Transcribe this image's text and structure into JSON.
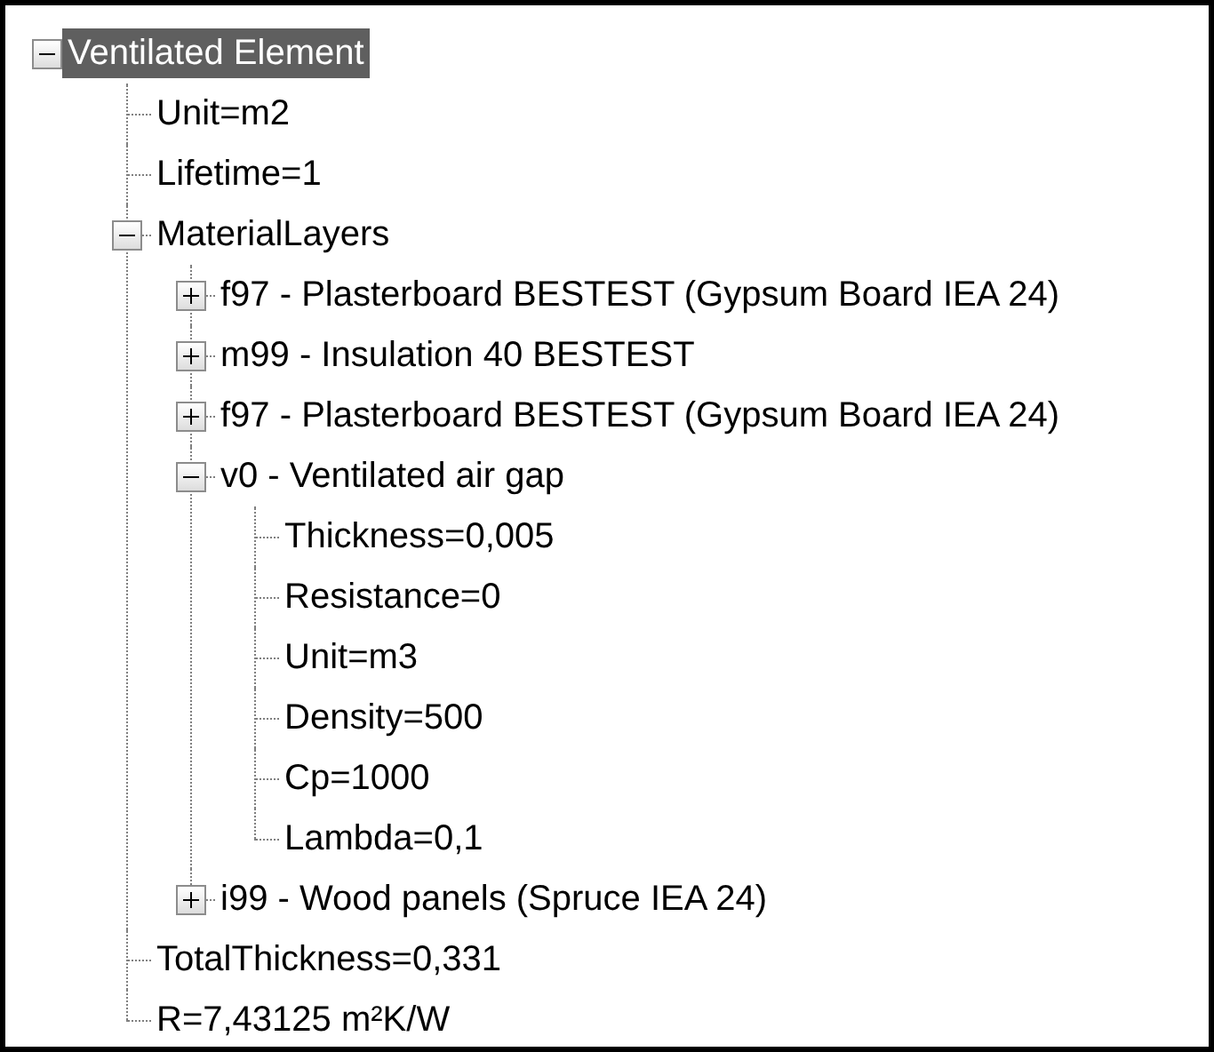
{
  "tree": [
    {
      "label": "Ventilated Element",
      "selected": true,
      "expanded": true,
      "children": [
        {
          "label": "Unit=m2",
          "selected": false
        },
        {
          "label": "Lifetime=1",
          "selected": false
        },
        {
          "label": "MaterialLayers",
          "selected": false,
          "expanded": true,
          "children": [
            {
              "label": "f97 - Plasterboard BESTEST (Gypsum Board IEA 24)",
              "selected": false,
              "expanded": false
            },
            {
              "label": "m99 - Insulation 40 BESTEST",
              "selected": false,
              "expanded": false
            },
            {
              "label": "f97 - Plasterboard BESTEST (Gypsum Board IEA 24)",
              "selected": false,
              "expanded": false
            },
            {
              "label": "v0 - Ventilated air gap",
              "selected": false,
              "expanded": true,
              "children": [
                {
                  "label": "Thickness=0,005",
                  "selected": false
                },
                {
                  "label": "Resistance=0",
                  "selected": false
                },
                {
                  "label": "Unit=m3",
                  "selected": false
                },
                {
                  "label": "Density=500",
                  "selected": false
                },
                {
                  "label": "Cp=1000",
                  "selected": false
                },
                {
                  "label": "Lambda=0,1",
                  "selected": false
                }
              ]
            },
            {
              "label": "i99 - Wood panels (Spruce IEA 24)",
              "selected": false,
              "expanded": false
            }
          ]
        },
        {
          "label": "TotalThickness=0,331",
          "selected": false
        },
        {
          "label": "R=7,43125 m²K/W",
          "selected": false
        }
      ]
    }
  ]
}
